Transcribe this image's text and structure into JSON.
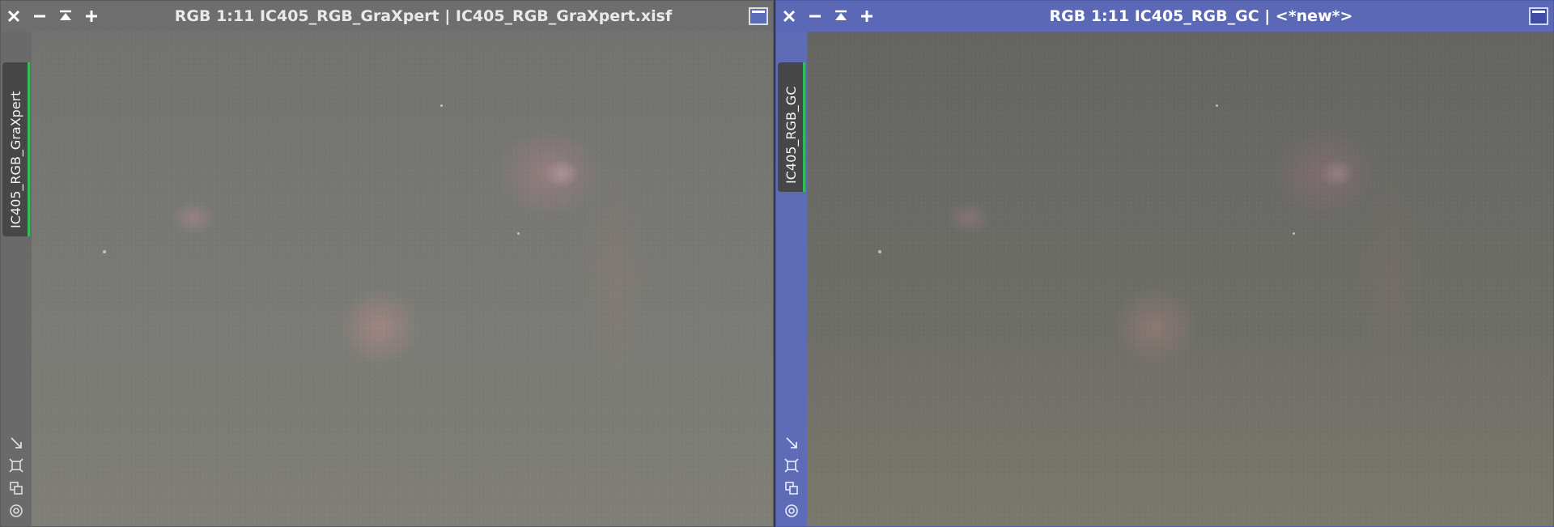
{
  "windows": [
    {
      "title": "RGB 1:11 IC405_RGB_GraXpert | IC405_RGB_GraXpert.xisf",
      "tab_label": "IC405_RGB_GraXpert",
      "active": false
    },
    {
      "title": "RGB 1:11 IC405_RGB_GC | <*new*>",
      "tab_label": "IC405_RGB_GC",
      "active": true
    }
  ],
  "icons": {
    "close": "close-icon",
    "minimize": "minimize-icon",
    "shade": "shade-icon",
    "zoom_in": "plus-icon",
    "maximize": "maximize-icon",
    "tool_diag": "diagonal-arrow-icon",
    "tool_fit": "fit-view-icon",
    "tool_clone": "clone-icon",
    "tool_target": "target-icon"
  },
  "colors": {
    "active_title": "#5b68b6",
    "inactive_title": "#6e6e6e",
    "tab_accent": "#2fbf55"
  }
}
